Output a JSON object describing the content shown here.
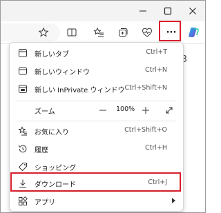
{
  "window": {
    "minimize_glyph": "—",
    "maximize_glyph": "☐",
    "close_glyph": "✕"
  },
  "toolbar": {
    "more_glyph": "···"
  },
  "background_text": "3",
  "menu": {
    "new_tab": {
      "label": "新しいタブ",
      "shortcut": "Ctrl+T"
    },
    "new_window": {
      "label": "新しいウィンドウ",
      "shortcut": "Ctrl+N"
    },
    "new_inprivate": {
      "label": "新しい InPrivate ウィンドウ",
      "shortcut": "Ctrl+Shift+N"
    },
    "zoom": {
      "label": "ズーム",
      "minus": "—",
      "value": "100%",
      "plus": "+"
    },
    "favorites": {
      "label": "お気に入り",
      "shortcut": "Ctrl+Shift+O"
    },
    "history": {
      "label": "履歴",
      "shortcut": "Ctrl+H"
    },
    "shopping": {
      "label": "ショッピング",
      "shortcut": ""
    },
    "downloads": {
      "label": "ダウンロード",
      "shortcut": "Ctrl+J"
    },
    "apps": {
      "label": "アプリ",
      "shortcut": ""
    }
  },
  "colors": {
    "highlight": "#d81e2c",
    "copilot_a": "#1bb0e8",
    "copilot_b": "#7a4bd8"
  }
}
